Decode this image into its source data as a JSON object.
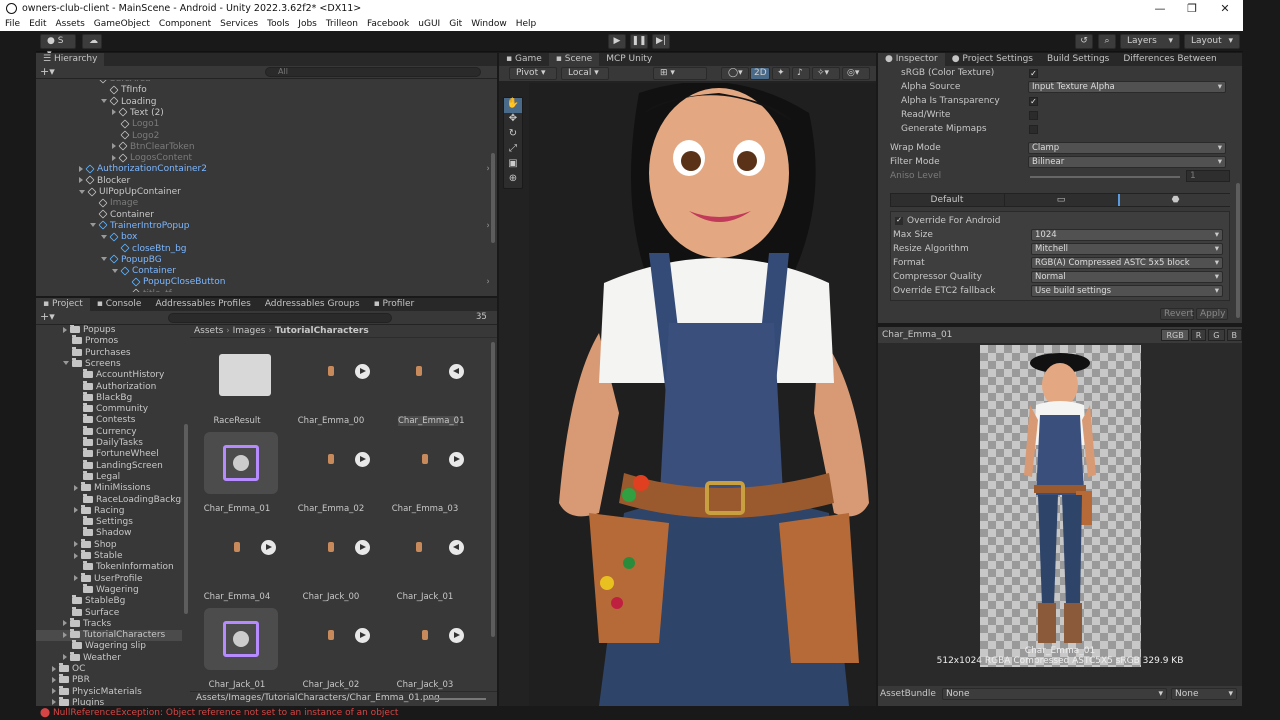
{
  "window": {
    "title": "owners-club-client - MainScene - Android - Unity 2022.3.62f2* <DX11>"
  },
  "menu": [
    "File",
    "Edit",
    "Assets",
    "GameObject",
    "Component",
    "Services",
    "Tools",
    "Jobs",
    "Trilleon",
    "Facebook",
    "uGUI",
    "Git",
    "Window",
    "Help"
  ],
  "toolbar": {
    "account": "S",
    "layers": "Layers",
    "layout": "Layout"
  },
  "hierarchy": {
    "tab": "Hierarchy",
    "search_placeholder": "All",
    "rows": [
      {
        "label": "SafeArea",
        "indent": 0,
        "style": "dim"
      },
      {
        "label": "TfInfo",
        "indent": 1
      },
      {
        "label": "Loading",
        "indent": 1,
        "fold": "open"
      },
      {
        "label": "Text (2)",
        "indent": 2,
        "fold": "closed"
      },
      {
        "label": "Logo1",
        "indent": 2,
        "style": "dim"
      },
      {
        "label": "Logo2",
        "indent": 2,
        "style": "dim"
      },
      {
        "label": "BtnClearToken",
        "indent": 2,
        "fold": "closed",
        "style": "dim"
      },
      {
        "label": "LogosContent",
        "indent": 2,
        "fold": "closed",
        "style": "dim"
      },
      {
        "label": "AuthorizationContainer2",
        "indent": -1,
        "fold": "closed",
        "style": "blue",
        "arrow": "›"
      },
      {
        "label": "Blocker",
        "indent": -1,
        "fold": "closed"
      },
      {
        "label": "UIPopUpContainer",
        "indent": -1,
        "fold": "open"
      },
      {
        "label": "Image",
        "indent": 0,
        "style": "dim"
      },
      {
        "label": "Container",
        "indent": 0
      },
      {
        "label": "TrainerIntroPopup",
        "indent": 0,
        "fold": "open",
        "style": "blue",
        "arrow": "›"
      },
      {
        "label": "box",
        "indent": 1,
        "fold": "open",
        "style": "blue"
      },
      {
        "label": "closeBtn_bg",
        "indent": 2,
        "style": "blue"
      },
      {
        "label": "PopupBG",
        "indent": 1,
        "fold": "open",
        "style": "blue"
      },
      {
        "label": "Container",
        "indent": 2,
        "fold": "open",
        "style": "blue"
      },
      {
        "label": "PopupCloseButton",
        "indent": 3,
        "style": "blue",
        "arrow": "›"
      },
      {
        "label": "title_tf",
        "indent": 3,
        "style": "dim"
      }
    ]
  },
  "project": {
    "tabs": [
      "Project",
      "Console",
      "Addressables Profiles",
      "Addressables Groups",
      "Profiler"
    ],
    "count": "35",
    "breadcrumb": [
      "Assets",
      "Images",
      "TutorialCharacters"
    ],
    "tree": [
      {
        "label": "Popups",
        "indent": 1,
        "fold": "closed"
      },
      {
        "label": "Promos",
        "indent": 1
      },
      {
        "label": "Purchases",
        "indent": 1
      },
      {
        "label": "Screens",
        "indent": 1,
        "fold": "open"
      },
      {
        "label": "AccountHistory",
        "indent": 2
      },
      {
        "label": "Authorization",
        "indent": 2
      },
      {
        "label": "BlackBg",
        "indent": 2
      },
      {
        "label": "Community",
        "indent": 2
      },
      {
        "label": "Contests",
        "indent": 2
      },
      {
        "label": "Currency",
        "indent": 2
      },
      {
        "label": "DailyTasks",
        "indent": 2
      },
      {
        "label": "FortuneWheel",
        "indent": 2
      },
      {
        "label": "LandingScreen",
        "indent": 2
      },
      {
        "label": "Legal",
        "indent": 2
      },
      {
        "label": "MiniMissions",
        "indent": 2,
        "fold": "closed"
      },
      {
        "label": "RaceLoadingBackgro",
        "indent": 2
      },
      {
        "label": "Racing",
        "indent": 2,
        "fold": "closed"
      },
      {
        "label": "Settings",
        "indent": 2
      },
      {
        "label": "Shadow",
        "indent": 2
      },
      {
        "label": "Shop",
        "indent": 2,
        "fold": "closed"
      },
      {
        "label": "Stable",
        "indent": 2,
        "fold": "closed"
      },
      {
        "label": "TokenInformation",
        "indent": 2
      },
      {
        "label": "UserProfile",
        "indent": 2,
        "fold": "closed"
      },
      {
        "label": "Wagering",
        "indent": 2
      },
      {
        "label": "StableBg",
        "indent": 1
      },
      {
        "label": "Surface",
        "indent": 1
      },
      {
        "label": "Tracks",
        "indent": 1,
        "fold": "closed"
      },
      {
        "label": "TutorialCharacters",
        "indent": 1,
        "fold": "closed",
        "selected": true
      },
      {
        "label": "Wagering slip",
        "indent": 1
      },
      {
        "label": "Weather",
        "indent": 1,
        "fold": "closed"
      },
      {
        "label": "OC",
        "indent": 0,
        "fold": "closed"
      },
      {
        "label": "PBR",
        "indent": 0,
        "fold": "closed"
      },
      {
        "label": "PhysicMaterials",
        "indent": 0,
        "fold": "closed"
      },
      {
        "label": "Plugins",
        "indent": 0,
        "fold": "closed"
      }
    ],
    "assets": [
      {
        "label": "RaceResult",
        "kind": "folder"
      },
      {
        "label": "Char_Emma_00",
        "kind": "anim",
        "dir": "right"
      },
      {
        "label": "Char_Emma_01",
        "kind": "anim",
        "dir": "left",
        "highlight": true
      },
      {
        "label": "Char_Emma_01",
        "kind": "controller"
      },
      {
        "label": "Char_Emma_02",
        "kind": "anim",
        "dir": "right"
      },
      {
        "label": "Char_Emma_03",
        "kind": "anim",
        "dir": "right"
      },
      {
        "label": "Char_Emma_04",
        "kind": "anim",
        "dir": "right"
      },
      {
        "label": "Char_Jack_00",
        "kind": "anim",
        "dir": "right"
      },
      {
        "label": "Char_Jack_01",
        "kind": "anim",
        "dir": "left"
      },
      {
        "label": "Char_Jack_01",
        "kind": "controller"
      },
      {
        "label": "Char_Jack_02",
        "kind": "anim",
        "dir": "right"
      },
      {
        "label": "Char_Jack_03",
        "kind": "anim",
        "dir": "right"
      }
    ],
    "path": "Assets/Images/TutorialCharacters/Char_Emma_01.png"
  },
  "scene": {
    "tabs": [
      "Game",
      "Scene",
      "MCP Unity"
    ],
    "pivot": "Pivot",
    "space": "Local",
    "mode2d": "2D"
  },
  "inspector": {
    "tabs": [
      "Inspector",
      "Project Settings",
      "Build Settings",
      "Differences Between"
    ],
    "props": [
      {
        "label": "sRGB (Color Texture)",
        "type": "check",
        "value": "✓"
      },
      {
        "label": "Alpha Source",
        "type": "dropdown",
        "value": "Input Texture Alpha"
      },
      {
        "label": "Alpha Is Transparency",
        "type": "check",
        "value": "✓"
      },
      {
        "label": "Read/Write",
        "type": "check",
        "value": ""
      },
      {
        "label": "Generate Mipmaps",
        "type": "check",
        "value": ""
      }
    ],
    "wrap_mode": {
      "label": "Wrap Mode",
      "value": "Clamp"
    },
    "filter_mode": {
      "label": "Filter Mode",
      "value": "Bilinear"
    },
    "aniso": {
      "label": "Aniso Level",
      "value": "1"
    },
    "platform_default": "Default",
    "override": {
      "label": "Override For Android",
      "value": "✓"
    },
    "platform_props": [
      {
        "label": "Max Size",
        "value": "1024"
      },
      {
        "label": "Resize Algorithm",
        "value": "Mitchell"
      },
      {
        "label": "Format",
        "value": "RGB(A) Compressed ASTC 5x5 block"
      },
      {
        "label": "Compressor Quality",
        "value": "Normal"
      },
      {
        "label": "Override ETC2 fallback",
        "value": "Use build settings"
      }
    ],
    "revert": "Revert",
    "apply": "Apply",
    "preview_title": "Char_Emma_01",
    "channels": [
      "RGB",
      "R",
      "G",
      "B"
    ],
    "preview_name": "Char_Emma_01",
    "preview_info": "512x1024  RGBA Compressed ASTC5X5 sRGB   329.9 KB",
    "asset_bundle": {
      "label": "AssetBundle",
      "value": "None",
      "variant": "None"
    }
  },
  "status": {
    "error": "NullReferenceException: Object reference not set to an instance of an object"
  },
  "colors": {
    "selected_blue": "#7cb7ff",
    "error": "#d64545",
    "accent": "#2c5d87"
  }
}
